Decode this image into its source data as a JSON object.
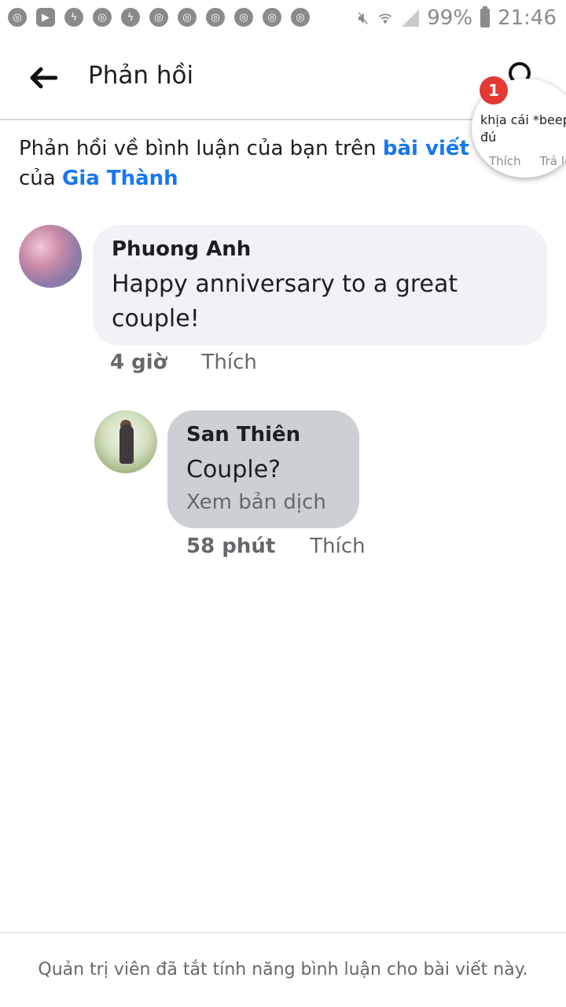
{
  "status_bar": {
    "battery": "99%",
    "time": "21:46",
    "notification_icons": [
      "chrome-icon",
      "youtube-icon",
      "messenger-icon",
      "chrome-icon",
      "messenger-icon",
      "chrome-icon",
      "chrome-icon",
      "chrome-icon",
      "chrome-icon",
      "chrome-icon",
      "chrome-icon"
    ]
  },
  "header": {
    "title": "Phản hồi"
  },
  "chat_head": {
    "badge": "1",
    "preview_line1": "khịa cái *beep*",
    "preview_line2": "đú",
    "like": "Thích",
    "reply": "Trả lời"
  },
  "context": {
    "prefix": "Phản hồi về bình luận của bạn trên ",
    "link1": "bài viết",
    "middle": " của ",
    "link2": "Gia Thành"
  },
  "comments": [
    {
      "author": "Phuong Anh",
      "text": "Happy anniversary to a great couple!",
      "time": "4 giờ",
      "like": "Thích"
    },
    {
      "author": "San Thiên",
      "text": "Couple?",
      "translate": "Xem bản dịch",
      "time": "58 phút",
      "like": "Thích"
    }
  ],
  "footer": {
    "text": "Quản trị viên đã tắt tính năng bình luận cho bài viết này."
  },
  "colors": {
    "link": "#1877f2",
    "bubble": "#f0f2f5",
    "bubble_selected": "#ccd0d5",
    "badge": "#e53935"
  }
}
